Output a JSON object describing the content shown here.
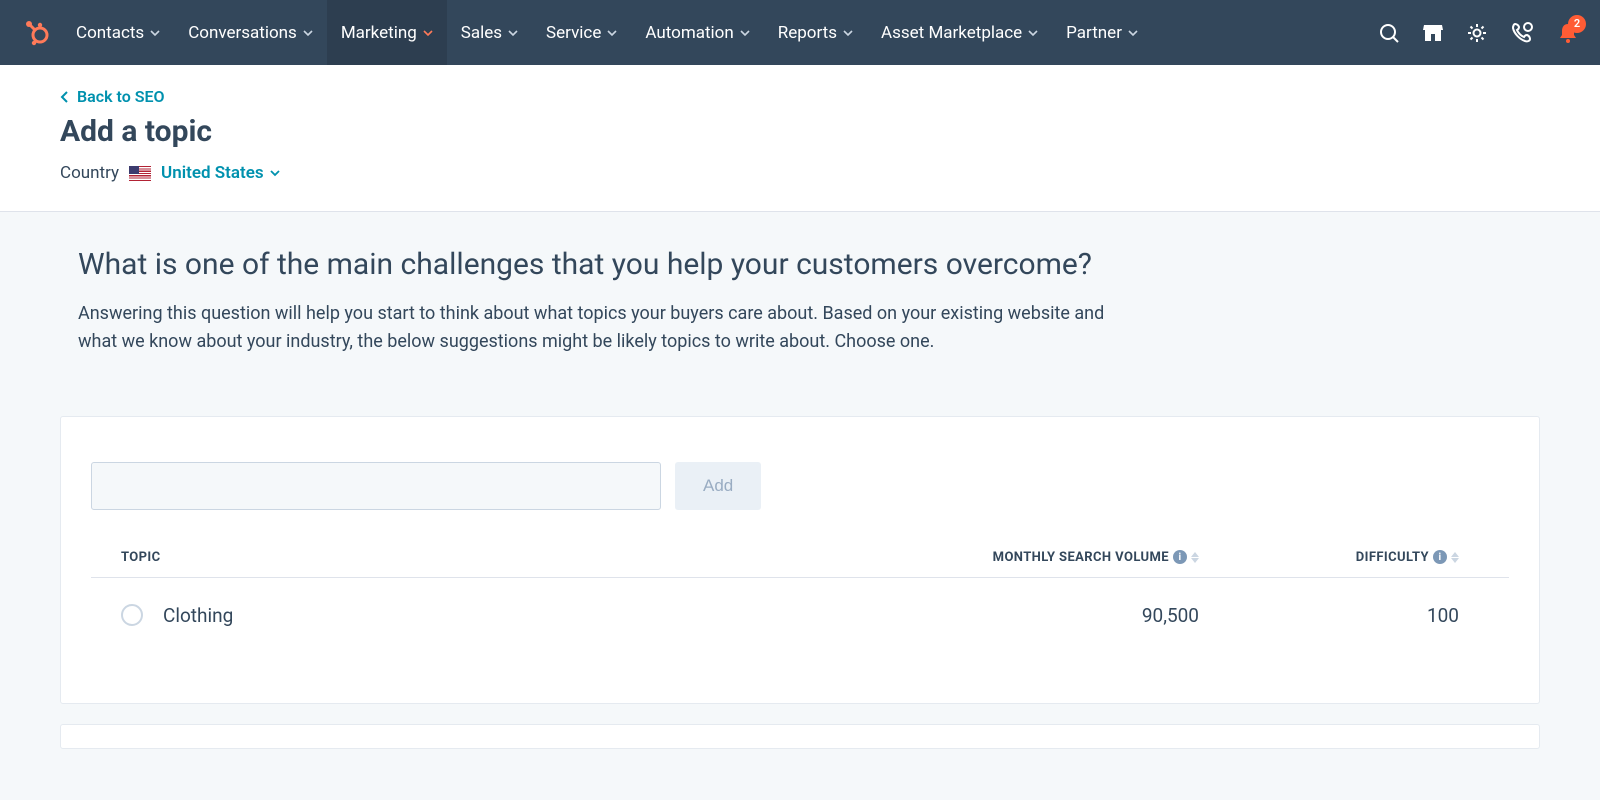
{
  "nav": {
    "items": [
      {
        "label": "Contacts"
      },
      {
        "label": "Conversations"
      },
      {
        "label": "Marketing",
        "active": true
      },
      {
        "label": "Sales"
      },
      {
        "label": "Service"
      },
      {
        "label": "Automation"
      },
      {
        "label": "Reports"
      },
      {
        "label": "Asset Marketplace"
      },
      {
        "label": "Partner"
      }
    ],
    "notif_count": "2"
  },
  "header": {
    "back_label": "Back to SEO",
    "title": "Add a topic",
    "country_label": "Country",
    "country_value": "United States"
  },
  "main": {
    "question": "What is one of the main challenges that you help your customers overcome?",
    "explainer": "Answering this question will help you start to think about what topics your buyers care about. Based on your existing website and what we know about your industry, the below suggestions might be likely topics to write about. Choose one.",
    "input_value": "",
    "add_label": "Add"
  },
  "table": {
    "columns": {
      "topic": "TOPIC",
      "msv": "MONTHLY SEARCH VOLUME",
      "difficulty": "DIFFICULTY"
    },
    "rows": [
      {
        "topic": "Clothing",
        "msv": "90,500",
        "difficulty": "100"
      }
    ]
  }
}
